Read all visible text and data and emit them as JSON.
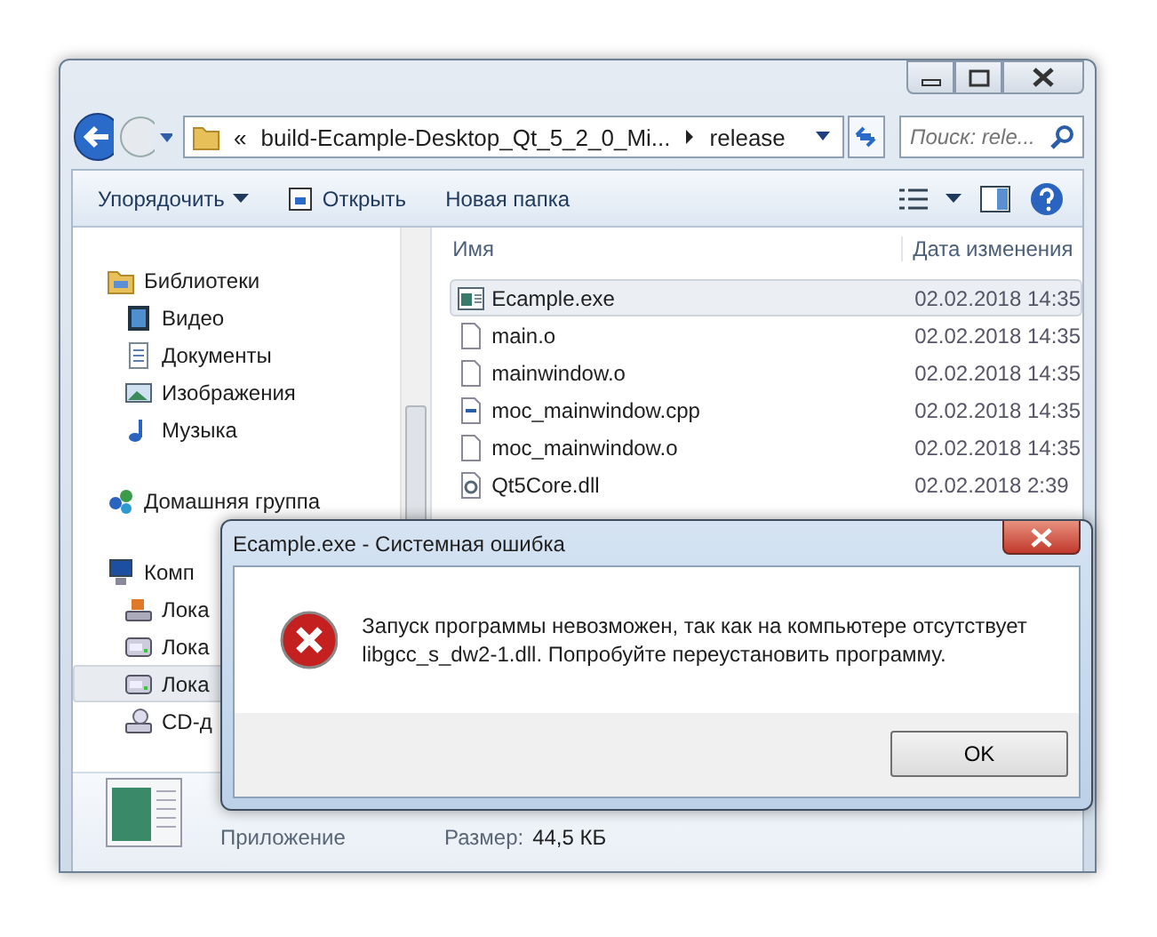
{
  "address_bar": {
    "overflow": "«",
    "crumbs": [
      "build-Ecample-Desktop_Qt_5_2_0_Mi...",
      "release"
    ]
  },
  "search": {
    "placeholder": "Поиск: rele..."
  },
  "toolbar": [
    {
      "label": "Упорядочить",
      "kind": "menu"
    },
    {
      "label": "Открыть",
      "kind": "open"
    },
    {
      "label": "Новая папка",
      "kind": "plain"
    }
  ],
  "sidebar": [
    {
      "label": "Библиотеки",
      "kind": "library",
      "selected": false,
      "children": [
        {
          "label": "Видео",
          "kind": "video",
          "selected": false
        },
        {
          "label": "Документы",
          "kind": "docs",
          "selected": false
        },
        {
          "label": "Изображения",
          "kind": "images",
          "selected": false
        },
        {
          "label": "Музыка",
          "kind": "music",
          "selected": false
        }
      ]
    },
    {
      "label": "Домашняя группа",
      "kind": "homegroup",
      "selected": false
    },
    {
      "label": "Комп",
      "kind": "computer",
      "selected": false,
      "children": [
        {
          "label": "Лока",
          "kind": "sysdrive",
          "selected": false
        },
        {
          "label": "Лока",
          "kind": "drive",
          "selected": false
        },
        {
          "label": "Лока",
          "kind": "drive",
          "selected": true
        },
        {
          "label": "CD-д",
          "kind": "cd",
          "selected": false
        }
      ]
    }
  ],
  "columns": [
    "Имя",
    "Дата изменения"
  ],
  "files": [
    {
      "name": "Ecample.exe",
      "date": "02.02.2018 14:35",
      "kind": "exe",
      "selected": true
    },
    {
      "name": "main.o",
      "date": "02.02.2018 14:35",
      "kind": "file",
      "selected": false
    },
    {
      "name": "mainwindow.o",
      "date": "02.02.2018 14:35",
      "kind": "file",
      "selected": false
    },
    {
      "name": "moc_mainwindow.cpp",
      "date": "02.02.2018 14:35",
      "kind": "cpp",
      "selected": false
    },
    {
      "name": "moc_mainwindow.o",
      "date": "02.02.2018 14:35",
      "kind": "file",
      "selected": false
    },
    {
      "name": "Qt5Core.dll",
      "date": "02.02.2018 2:39",
      "kind": "dll",
      "selected": false
    }
  ],
  "details": {
    "type": "Приложение",
    "size_label": "Размер:",
    "size": "44,5 КБ"
  },
  "dialog": {
    "title": "Ecample.exe - Системная ошибка",
    "message": "Запуск программы невозможен, так как на компьютере отсутствует libgcc_s_dw2-1.dll. Попробуйте переустановить программу.",
    "button": "OK"
  }
}
